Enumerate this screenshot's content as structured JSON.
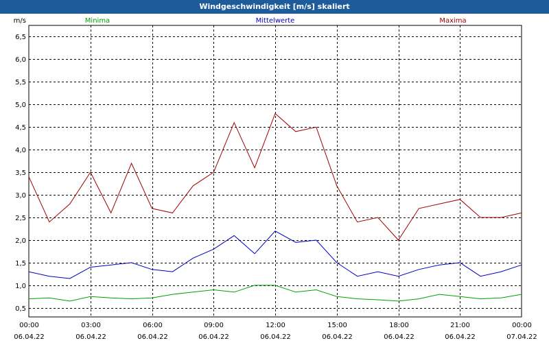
{
  "window": {
    "title": "Windgeschwindigkeit [m/s] skaliert"
  },
  "chart_data": {
    "type": "line",
    "title": "Windgeschwindigkeit [m/s] skaliert",
    "ylabel": "m/s",
    "xlabel": "",
    "ylim": [
      0.3,
      6.75
    ],
    "y_ticks": [
      "0,5",
      "1,0",
      "1,5",
      "2,0",
      "2,5",
      "3,0",
      "3,5",
      "4,0",
      "4,5",
      "5,0",
      "5,5",
      "6,0",
      "6,5"
    ],
    "y_tick_values": [
      0.5,
      1.0,
      1.5,
      2.0,
      2.5,
      3.0,
      3.5,
      4.0,
      4.5,
      5.0,
      5.5,
      6.0,
      6.5
    ],
    "x_range_hours": [
      0,
      24
    ],
    "x_ticks": [
      {
        "time": "00:00",
        "date": "06.04.22",
        "hour": 0
      },
      {
        "time": "03:00",
        "date": "06.04.22",
        "hour": 3
      },
      {
        "time": "06:00",
        "date": "06.04.22",
        "hour": 6
      },
      {
        "time": "09:00",
        "date": "06.04.22",
        "hour": 9
      },
      {
        "time": "12:00",
        "date": "06.04.22",
        "hour": 12
      },
      {
        "time": "15:00",
        "date": "06.04.22",
        "hour": 15
      },
      {
        "time": "18:00",
        "date": "06.04.22",
        "hour": 18
      },
      {
        "time": "21:00",
        "date": "06.04.22",
        "hour": 21
      },
      {
        "time": "00:00",
        "date": "07.04.22",
        "hour": 24
      }
    ],
    "grid": true,
    "legend_position": "top",
    "series": [
      {
        "name": "Minima",
        "color": "#00a000",
        "x": [
          0,
          1,
          2,
          3,
          4,
          5,
          6,
          7,
          8,
          9,
          10,
          11,
          12,
          13,
          14,
          15,
          16,
          17,
          18,
          19,
          20,
          21,
          22,
          23,
          24
        ],
        "y": [
          0.7,
          0.72,
          0.65,
          0.75,
          0.72,
          0.7,
          0.72,
          0.8,
          0.85,
          0.9,
          0.85,
          1.0,
          1.0,
          0.85,
          0.9,
          0.75,
          0.7,
          0.68,
          0.65,
          0.7,
          0.8,
          0.75,
          0.7,
          0.72,
          0.8
        ]
      },
      {
        "name": "Mittelwerte",
        "color": "#0000c0",
        "x": [
          0,
          1,
          2,
          3,
          4,
          5,
          6,
          7,
          8,
          9,
          10,
          11,
          12,
          13,
          14,
          15,
          16,
          17,
          18,
          19,
          20,
          21,
          22,
          23,
          24
        ],
        "y": [
          1.3,
          1.2,
          1.15,
          1.4,
          1.45,
          1.5,
          1.35,
          1.3,
          1.6,
          1.8,
          2.1,
          1.7,
          2.2,
          1.95,
          2.0,
          1.5,
          1.2,
          1.3,
          1.2,
          1.35,
          1.45,
          1.5,
          1.2,
          1.3,
          1.45
        ]
      },
      {
        "name": "Maxima",
        "color": "#a00000",
        "x": [
          0,
          1,
          2,
          3,
          4,
          5,
          6,
          7,
          8,
          9,
          10,
          11,
          12,
          13,
          14,
          15,
          16,
          17,
          18,
          19,
          20,
          21,
          22,
          23,
          24
        ],
        "y": [
          3.4,
          2.4,
          2.8,
          3.5,
          2.6,
          3.7,
          2.7,
          2.6,
          3.2,
          3.5,
          4.6,
          3.6,
          4.8,
          4.4,
          4.5,
          3.2,
          2.4,
          2.5,
          2.0,
          2.7,
          2.8,
          2.9,
          2.5,
          2.5,
          2.6
        ]
      }
    ]
  }
}
